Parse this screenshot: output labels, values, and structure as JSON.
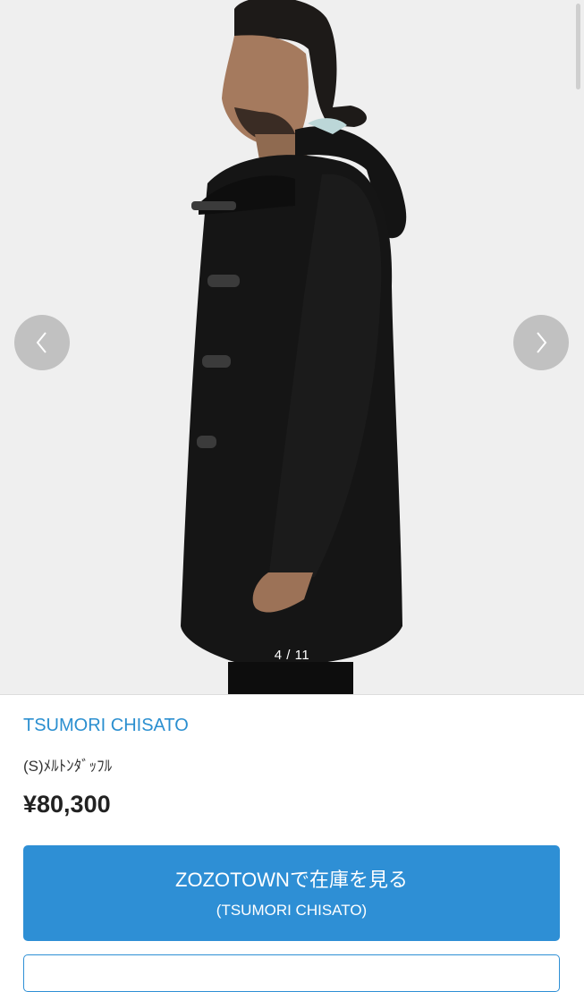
{
  "gallery": {
    "counter": "4 / 11",
    "current_image": 4,
    "total_images": 11,
    "prev_icon": "chevron-left-icon",
    "next_icon": "chevron-right-icon"
  },
  "product": {
    "brand": "TSUMORI CHISATO",
    "name": "(S)ﾒﾙﾄﾝﾀﾞｯﾌﾙ",
    "price": "¥80,300"
  },
  "cta": {
    "main_label": "ZOZOTOWNで在庫を見る",
    "sub_label": "(TSUMORI CHISATO)"
  },
  "colors": {
    "brand_link": "#2b8fd0",
    "cta_background": "#2e8fd5",
    "price_text": "#222222",
    "photo_background": "#eeeeee"
  }
}
